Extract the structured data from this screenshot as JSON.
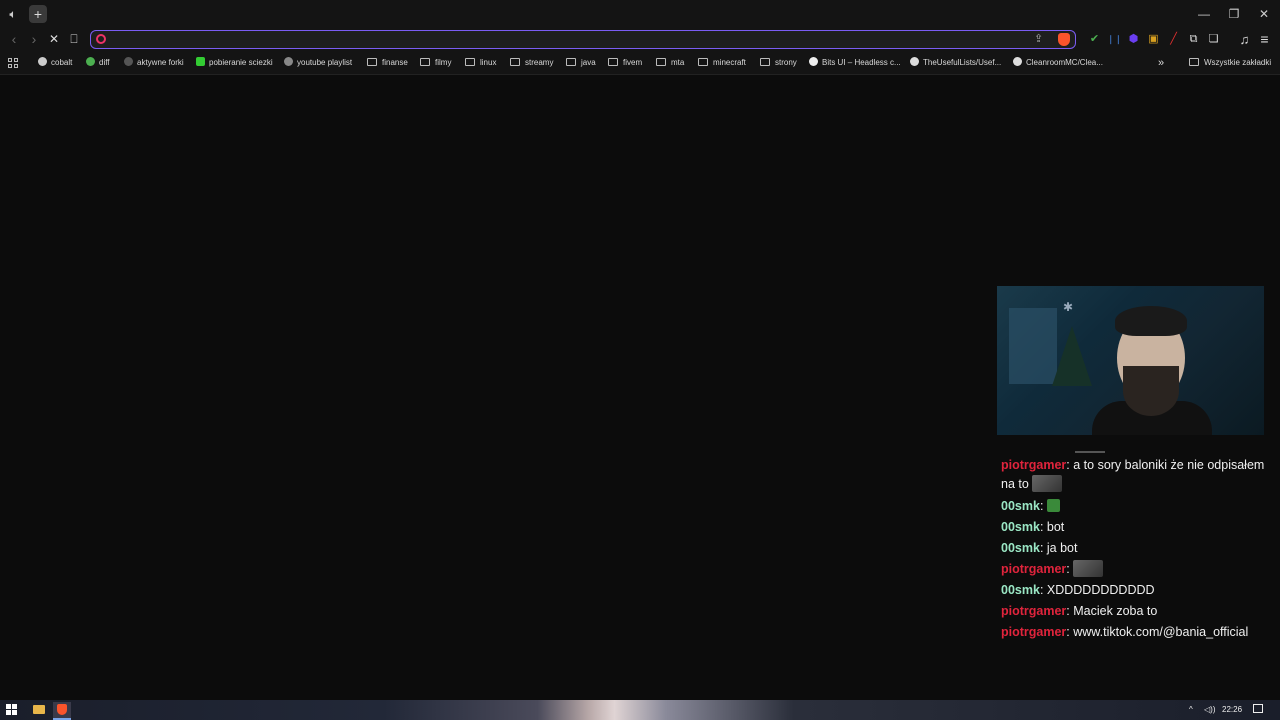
{
  "tabs": {
    "audio_icon": "speaker-icon",
    "new_tab": "+"
  },
  "window": {
    "minimize": "—",
    "restore": "❐",
    "close": "✕"
  },
  "nav": {
    "back": "‹",
    "forward": "›",
    "stop": "✕",
    "bookmark": "⎕"
  },
  "omnibox": {
    "value": "",
    "placeholder": "",
    "share": "⇪"
  },
  "extensions": [
    "✔",
    "❘❘",
    "⬢",
    "▣",
    "╱",
    "⧉",
    "❏"
  ],
  "toolbar_right": {
    "media": "♫",
    "menu": "≡"
  },
  "bookmarks": [
    {
      "label": "cobalt",
      "icon": "cobalt-icon"
    },
    {
      "label": "diff",
      "icon": "diff-icon"
    },
    {
      "label": "aktywne forki",
      "icon": "fork-icon"
    },
    {
      "label": "pobieranie sciezki",
      "icon": "download-icon"
    },
    {
      "label": "youtube playlist",
      "icon": "globe-icon"
    },
    {
      "label": "finanse",
      "icon": "folder-icon"
    },
    {
      "label": "filmy",
      "icon": "folder-icon"
    },
    {
      "label": "linux",
      "icon": "folder-icon"
    },
    {
      "label": "streamy",
      "icon": "folder-icon"
    },
    {
      "label": "java",
      "icon": "folder-icon"
    },
    {
      "label": "fivem",
      "icon": "folder-icon"
    },
    {
      "label": "mta",
      "icon": "folder-icon"
    },
    {
      "label": "minecraft",
      "icon": "folder-icon"
    },
    {
      "label": "strony",
      "icon": "folder-icon"
    },
    {
      "label": "Bits UI – Headless c...",
      "icon": "dot-icon"
    },
    {
      "label": "TheUsefulLists/Usef...",
      "icon": "github-icon"
    },
    {
      "label": "CleanroomMC/Clea...",
      "icon": "github-icon"
    }
  ],
  "bookmarks_overflow": "»",
  "all_bookmarks": "Wszystkie zakładki",
  "chat": {
    "colors": {
      "piotrgamer": "#e0243c",
      "00smk": "#9ae6c4"
    },
    "messages": [
      {
        "user": "piotrgamer",
        "text": "a to sory baloniki że nie odpisałem na to",
        "emote": true
      },
      {
        "user": "00smk",
        "text": "",
        "emote_green": true
      },
      {
        "user": "00smk",
        "text": "bot"
      },
      {
        "user": "00smk",
        "text": "ja bot"
      },
      {
        "user": "piotrgamer",
        "text": "",
        "emote": true
      },
      {
        "user": "00smk",
        "text": "XDDDDDDDDDDD"
      },
      {
        "user": "piotrgamer",
        "text": "Maciek zoba to"
      },
      {
        "user": "piotrgamer",
        "text": "www.tiktok.com/@bania_official"
      }
    ]
  },
  "taskbar": {
    "clock": "22:26",
    "tray_arrow": "^",
    "volume": "◁))"
  }
}
